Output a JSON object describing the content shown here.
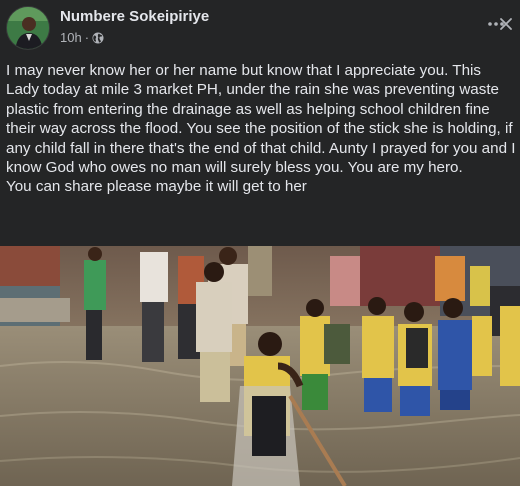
{
  "post": {
    "author": "Numbere Sokeipiriye",
    "time": "10h",
    "separator": "·",
    "audience_icon": "globe-icon",
    "message": "I may never know her or her name but know that I appreciate you. This Lady today at mile 3 market PH, under the rain she was preventing waste plastic from entering the drainage as well as helping school children fine their way across the flood. You see the position of the stick she is holding, if any child fall in there that's the end of that child. Aunty I prayed for you and I know God who owes no man will surely bless you. You are my hero.\nYou can share please maybe it will get to her"
  },
  "icons": {
    "more": "more-horizontal-icon",
    "close": "close-icon"
  },
  "colors": {
    "background": "#242526",
    "text_primary": "#e4e6eb",
    "text_secondary": "#b0b3b8",
    "flood_water": "#8a7f6a",
    "school_uniform_yellow": "#e2c44a",
    "school_uniform_blue": "#2f55a8"
  }
}
